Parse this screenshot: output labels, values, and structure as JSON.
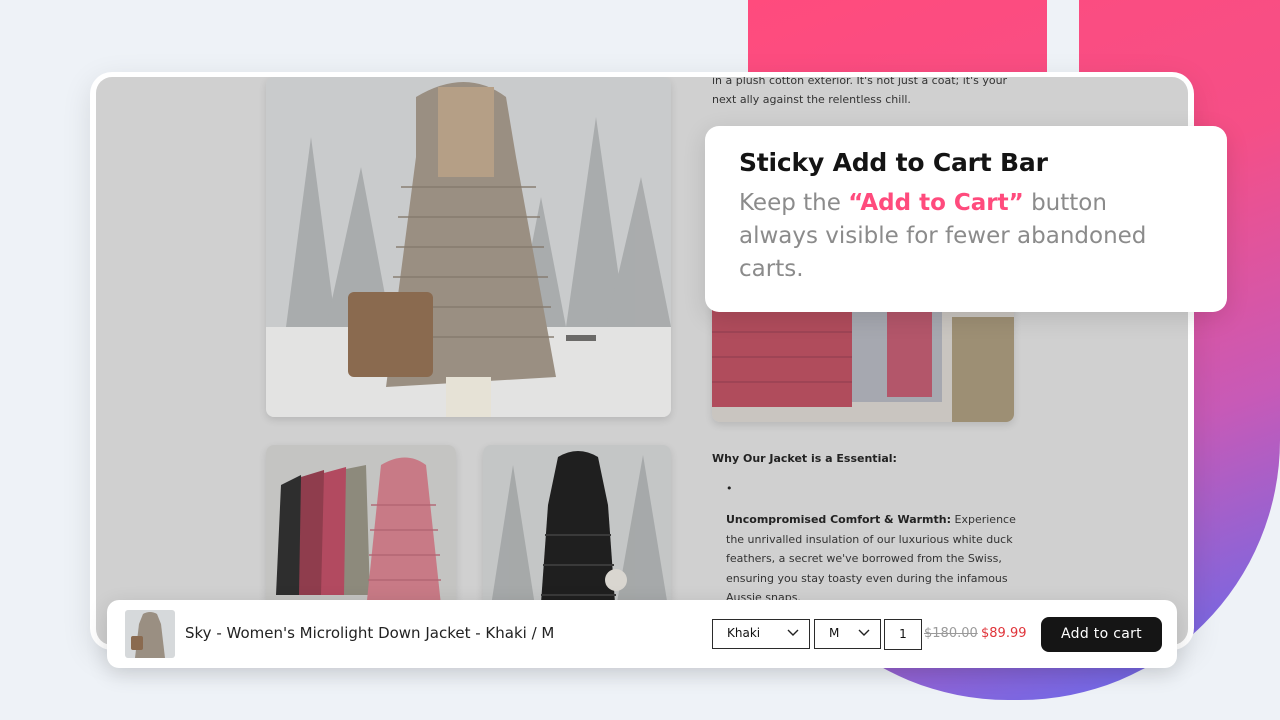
{
  "callout": {
    "title": "Sticky Add to Cart Bar",
    "body_prefix": "Keep the ",
    "body_accent": "“Add to Cart”",
    "body_suffix": " button always visible for fewer abandoned carts."
  },
  "product_page": {
    "desc_top": "in a plush cotton exterior. It's not just a coat; it's your next ally against the relentless chill.",
    "section_heading": "Why Our Jacket is a Essential:",
    "bullet_marker": "•",
    "feature_title": "Uncompromised Comfort & Warmth:",
    "feature_text": " Experience the unrivalled insulation of our luxurious white duck feathers, a secret we've borrowed from the Swiss, ensuring you stay toasty even during the infamous Aussie snaps."
  },
  "sticky_bar": {
    "product_name": "Sky - Women's Microlight Down Jacket - Khaki / M",
    "color_value": "Khaki",
    "size_value": "M",
    "quantity": "1",
    "price_old": "$180.00",
    "price_new": "$89.99",
    "add_button": "Add to cart",
    "chevron": "⌵"
  },
  "colors": {
    "accent": "#ff4b7d",
    "button": "#151515",
    "price_sale": "#e0343a"
  }
}
